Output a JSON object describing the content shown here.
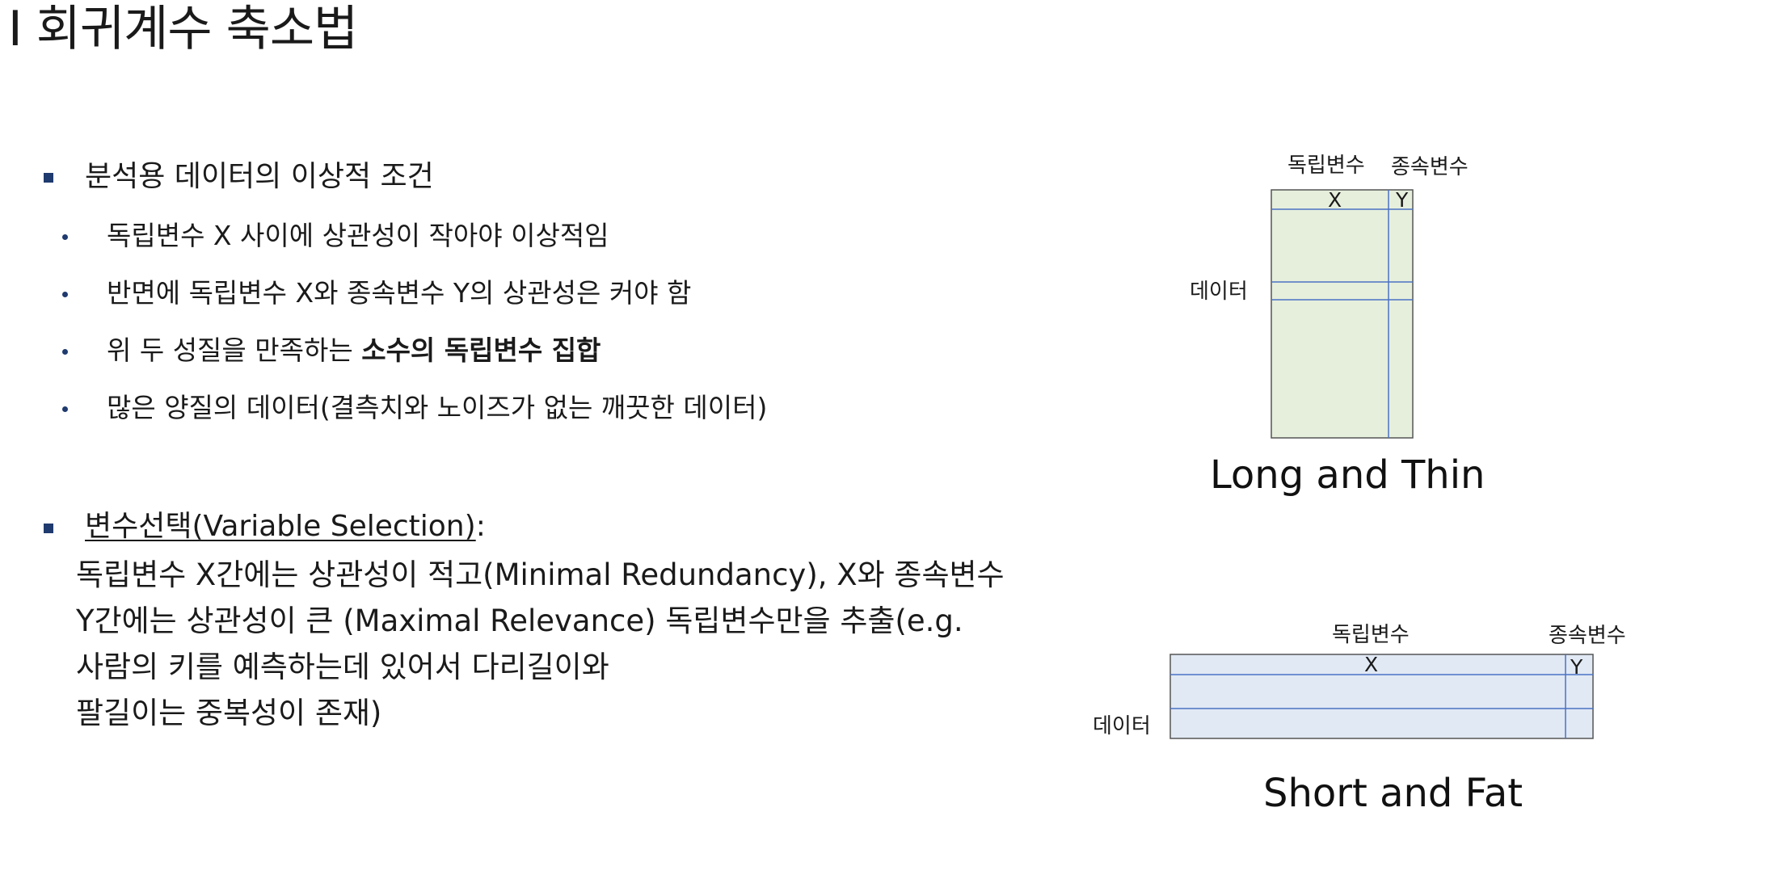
{
  "title": "I 회귀계수 축소법",
  "section1": {
    "heading": "분석용 데이터의 이상적 조건",
    "items": [
      {
        "text": "독립변수 X 사이에 상관성이 작아야 이상적임",
        "bold": ""
      },
      {
        "text": "반면에 독립변수 X와 종속변수 Y의 상관성은 커야 함",
        "bold": ""
      },
      {
        "text": "위 두 성질을 만족하는 ",
        "bold": "소수의 독립변수 집합"
      },
      {
        "text": "많은 양질의 데이터(결측치와 노이즈가 없는 깨끗한 데이터)",
        "bold": ""
      }
    ]
  },
  "section2": {
    "heading": "변수선택(Variable Selection)",
    "heading_suffix": ":",
    "lines": [
      "독립변수 X간에는 상관성이 적고(Minimal Redundancy), X와 종속변수",
      "Y간에는 상관성이 큰 (Maximal Relevance) 독립변수만을 추출(e.g.",
      "사람의 키를 예측하는데 있어서 다리길이와",
      "팔길이는 중복성이 존재)"
    ]
  },
  "diagram_long": {
    "label_independent": "독립변수",
    "label_dependent": "종속변수",
    "label_x": "X",
    "label_y": "Y",
    "label_data": "데이터",
    "caption": "Long and Thin",
    "fill_color": "#e6efdc",
    "border_color": "#555555",
    "line_color": "#4a72c4"
  },
  "diagram_short": {
    "label_independent": "독립변수",
    "label_dependent": "종속변수",
    "label_x": "X",
    "label_y": "Y",
    "label_data": "데이터",
    "caption": "Short and Fat",
    "fill_color": "#e1e9f4",
    "border_color": "#555555",
    "line_color": "#4a72c4"
  }
}
